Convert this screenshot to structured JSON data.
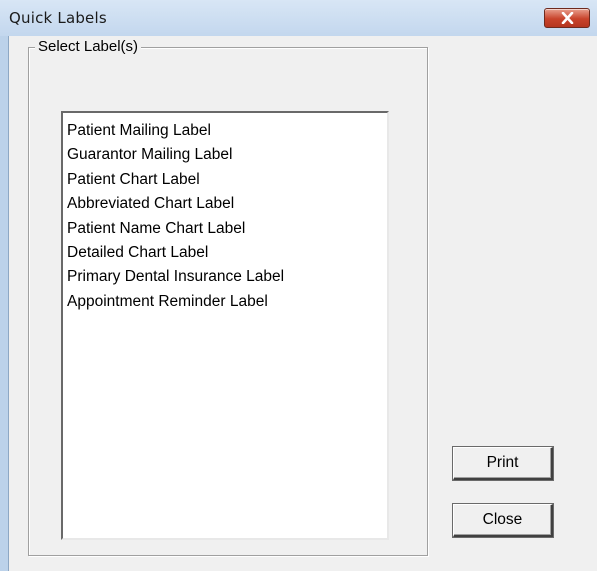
{
  "window": {
    "title": "Quick Labels"
  },
  "group": {
    "legend": "Select Label(s)"
  },
  "labels": [
    "Patient Mailing Label",
    "Guarantor Mailing Label",
    "Patient Chart Label",
    "Abbreviated Chart Label",
    "Patient Name Chart Label",
    "Detailed Chart Label",
    "Primary Dental Insurance Label",
    "Appointment Reminder Label"
  ],
  "buttons": {
    "print_label": "Print",
    "close_label": "Close"
  },
  "icons": {
    "close": "close-icon"
  },
  "colors": {
    "titlebar": "#c3d7ee",
    "close_button": "#c8432b",
    "dialog_background": "#f0f0f0"
  }
}
